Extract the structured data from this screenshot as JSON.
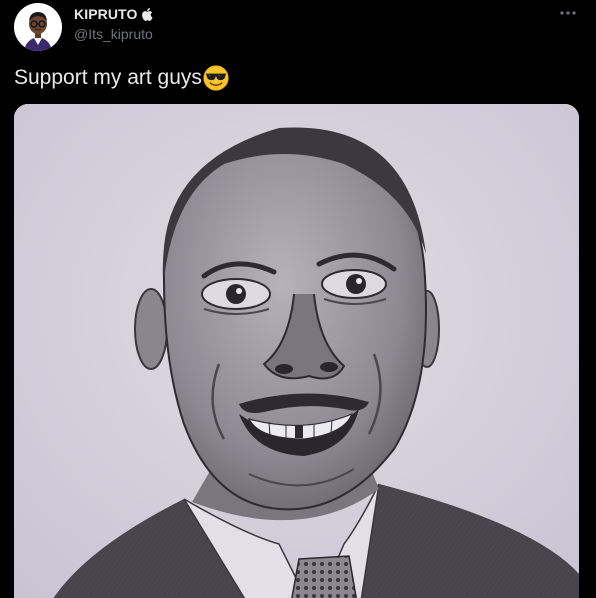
{
  "tweet": {
    "author": {
      "display_name": "KIPRUTO",
      "verified_icon": "apple-icon",
      "handle": "@Its_kipruto",
      "avatar_icon": "avatar-cartoon-icon"
    },
    "more_icon": "more-dots-icon",
    "text": "Support my art guys",
    "text_emoji": "smiling-face-with-sunglasses-icon",
    "media": {
      "kind": "photo",
      "subject_icon": "pencil-portrait-drawing-image"
    }
  },
  "colors": {
    "background": "#000000",
    "primary_text": "#e7e9ea",
    "secondary_text": "#71767b",
    "paper": "#d5d2dc"
  }
}
